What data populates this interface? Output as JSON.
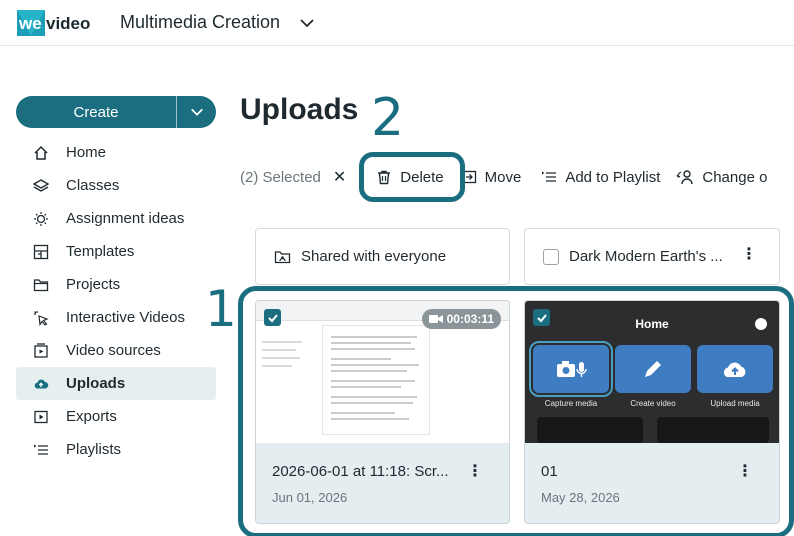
{
  "app": {
    "logo_text": "wevideo",
    "workspace_title": "Multimedia Creation",
    "accent_color": "#1a6e80"
  },
  "sidebar": {
    "create_label": "Create",
    "items": [
      {
        "label": "Home",
        "icon": "home-icon"
      },
      {
        "label": "Classes",
        "icon": "layers-icon"
      },
      {
        "label": "Assignment ideas",
        "icon": "lightbulb-icon"
      },
      {
        "label": "Templates",
        "icon": "templates-icon"
      },
      {
        "label": "Projects",
        "icon": "folder-icon"
      },
      {
        "label": "Interactive Videos",
        "icon": "cursor-click-icon"
      },
      {
        "label": "Video sources",
        "icon": "video-source-icon"
      },
      {
        "label": "Uploads",
        "icon": "upload-cloud-icon",
        "active": true
      },
      {
        "label": "Exports",
        "icon": "play-box-icon"
      },
      {
        "label": "Playlists",
        "icon": "playlist-icon"
      }
    ]
  },
  "main": {
    "title": "Uploads",
    "toolbar": {
      "selected_count": "(2) Selected",
      "clear_symbol": "✕",
      "delete_label": "Delete",
      "move_label": "Move",
      "add_to_playlist_label": "Add to Playlist",
      "change_label": "Change o"
    },
    "folders": [
      {
        "label": "Shared with everyone"
      },
      {
        "label": "Dark Modern Earth's ..."
      }
    ],
    "videos": [
      {
        "title": "2026-06-01 at 11:18: Scr...",
        "date": "Jun 01, 2026",
        "duration": "00:03:11",
        "selected": true
      },
      {
        "title": "01",
        "date": "May 28, 2026",
        "selected": true,
        "thumb": {
          "home_label": "Home",
          "tiles": [
            "Capture media",
            "Create video",
            "Upload media"
          ]
        }
      }
    ]
  },
  "annotations": {
    "marker_1": "1",
    "marker_2": "2"
  }
}
